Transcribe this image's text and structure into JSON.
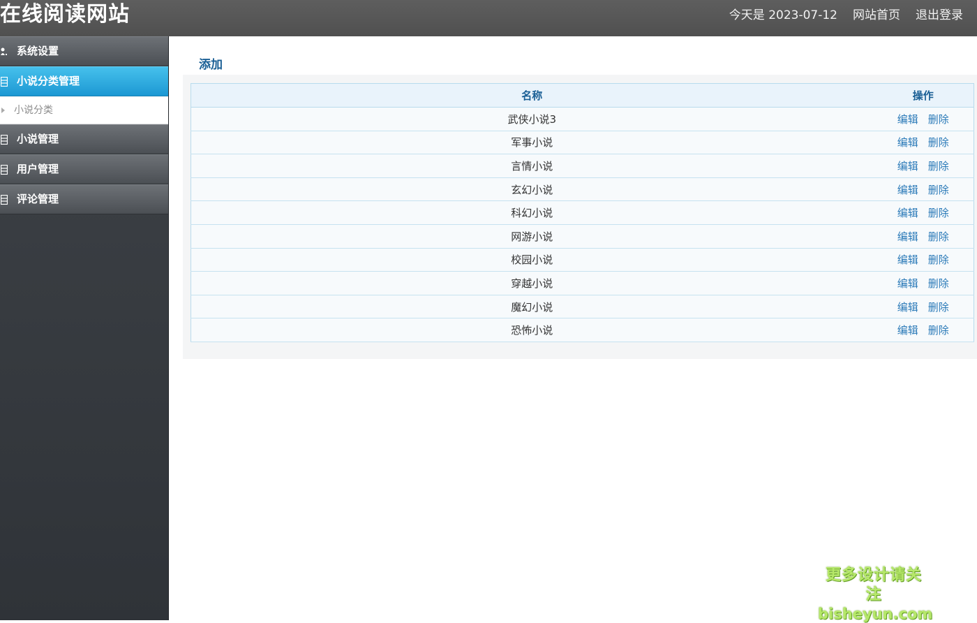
{
  "header": {
    "title": "在线阅读网站",
    "date_text": "今天是 2023-07-12",
    "home_link": "网站首页",
    "logout_link": "退出登录"
  },
  "sidebar": {
    "items": [
      {
        "label": "系统设置",
        "icon": "user-icon"
      },
      {
        "label": "小说分类管理",
        "icon": "list-icon",
        "active": true
      },
      {
        "label": "小说管理",
        "icon": "list-icon"
      },
      {
        "label": "用户管理",
        "icon": "list-icon"
      },
      {
        "label": "评论管理",
        "icon": "list-icon"
      }
    ],
    "sub_items": [
      {
        "label": "小说分类"
      }
    ]
  },
  "main": {
    "add_label": "添加",
    "table": {
      "headers": [
        "名称",
        "操作"
      ],
      "rows": [
        {
          "name": "武侠小说3"
        },
        {
          "name": "军事小说"
        },
        {
          "name": "言情小说"
        },
        {
          "name": "玄幻小说"
        },
        {
          "name": "科幻小说"
        },
        {
          "name": "网游小说"
        },
        {
          "name": "校园小说"
        },
        {
          "name": "穿越小说"
        },
        {
          "name": "魔幻小说"
        },
        {
          "name": "恐怖小说"
        }
      ],
      "edit_label": "编辑",
      "delete_label": "删除"
    }
  },
  "watermark": {
    "line1": "更多设计请关注",
    "line2": "bisheyun.com"
  },
  "colors": {
    "header_bg": "#575757",
    "sidebar_bg": "#363a3f",
    "active_nav": "#2aa9de",
    "link_blue": "#2b7ab8",
    "heading_blue": "#1a5f95"
  }
}
